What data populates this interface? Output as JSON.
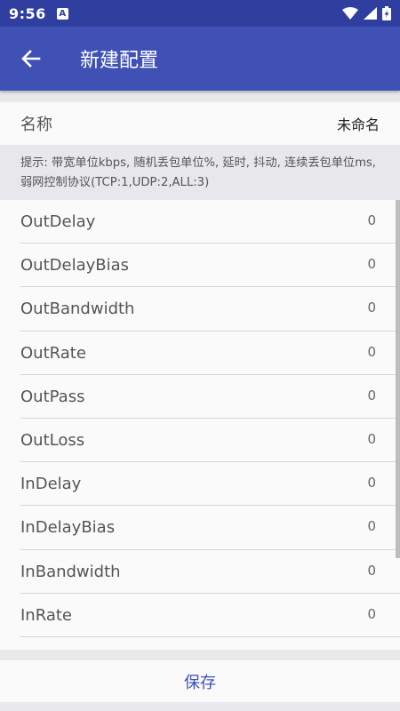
{
  "status_bar": {
    "time": "9:56",
    "notification_glyph": "A",
    "icons": [
      "wifi-icon",
      "cell-signal-icon",
      "battery-charging-icon"
    ]
  },
  "app_bar": {
    "back_icon": "arrow-left-icon",
    "title": "新建配置"
  },
  "name_field": {
    "label": "名称",
    "value": "未命名"
  },
  "tip": "提示: 带宽单位kbps, 随机丢包单位%, 延时, 抖动, 连续丢包单位ms, 弱网控制协议(TCP:1,UDP:2,ALL:3)",
  "params": [
    {
      "key": "OutDelay",
      "value": "0"
    },
    {
      "key": "OutDelayBias",
      "value": "0"
    },
    {
      "key": "OutBandwidth",
      "value": "0"
    },
    {
      "key": "OutRate",
      "value": "0"
    },
    {
      "key": "OutPass",
      "value": "0"
    },
    {
      "key": "OutLoss",
      "value": "0"
    },
    {
      "key": "InDelay",
      "value": "0"
    },
    {
      "key": "InDelayBias",
      "value": "0"
    },
    {
      "key": "InBandwidth",
      "value": "0"
    },
    {
      "key": "InRate",
      "value": "0"
    }
  ],
  "save_label": "保存",
  "colors": {
    "primary": "#3f51b5",
    "primary_dark": "#303f9f",
    "background": "#e9e9ec"
  }
}
